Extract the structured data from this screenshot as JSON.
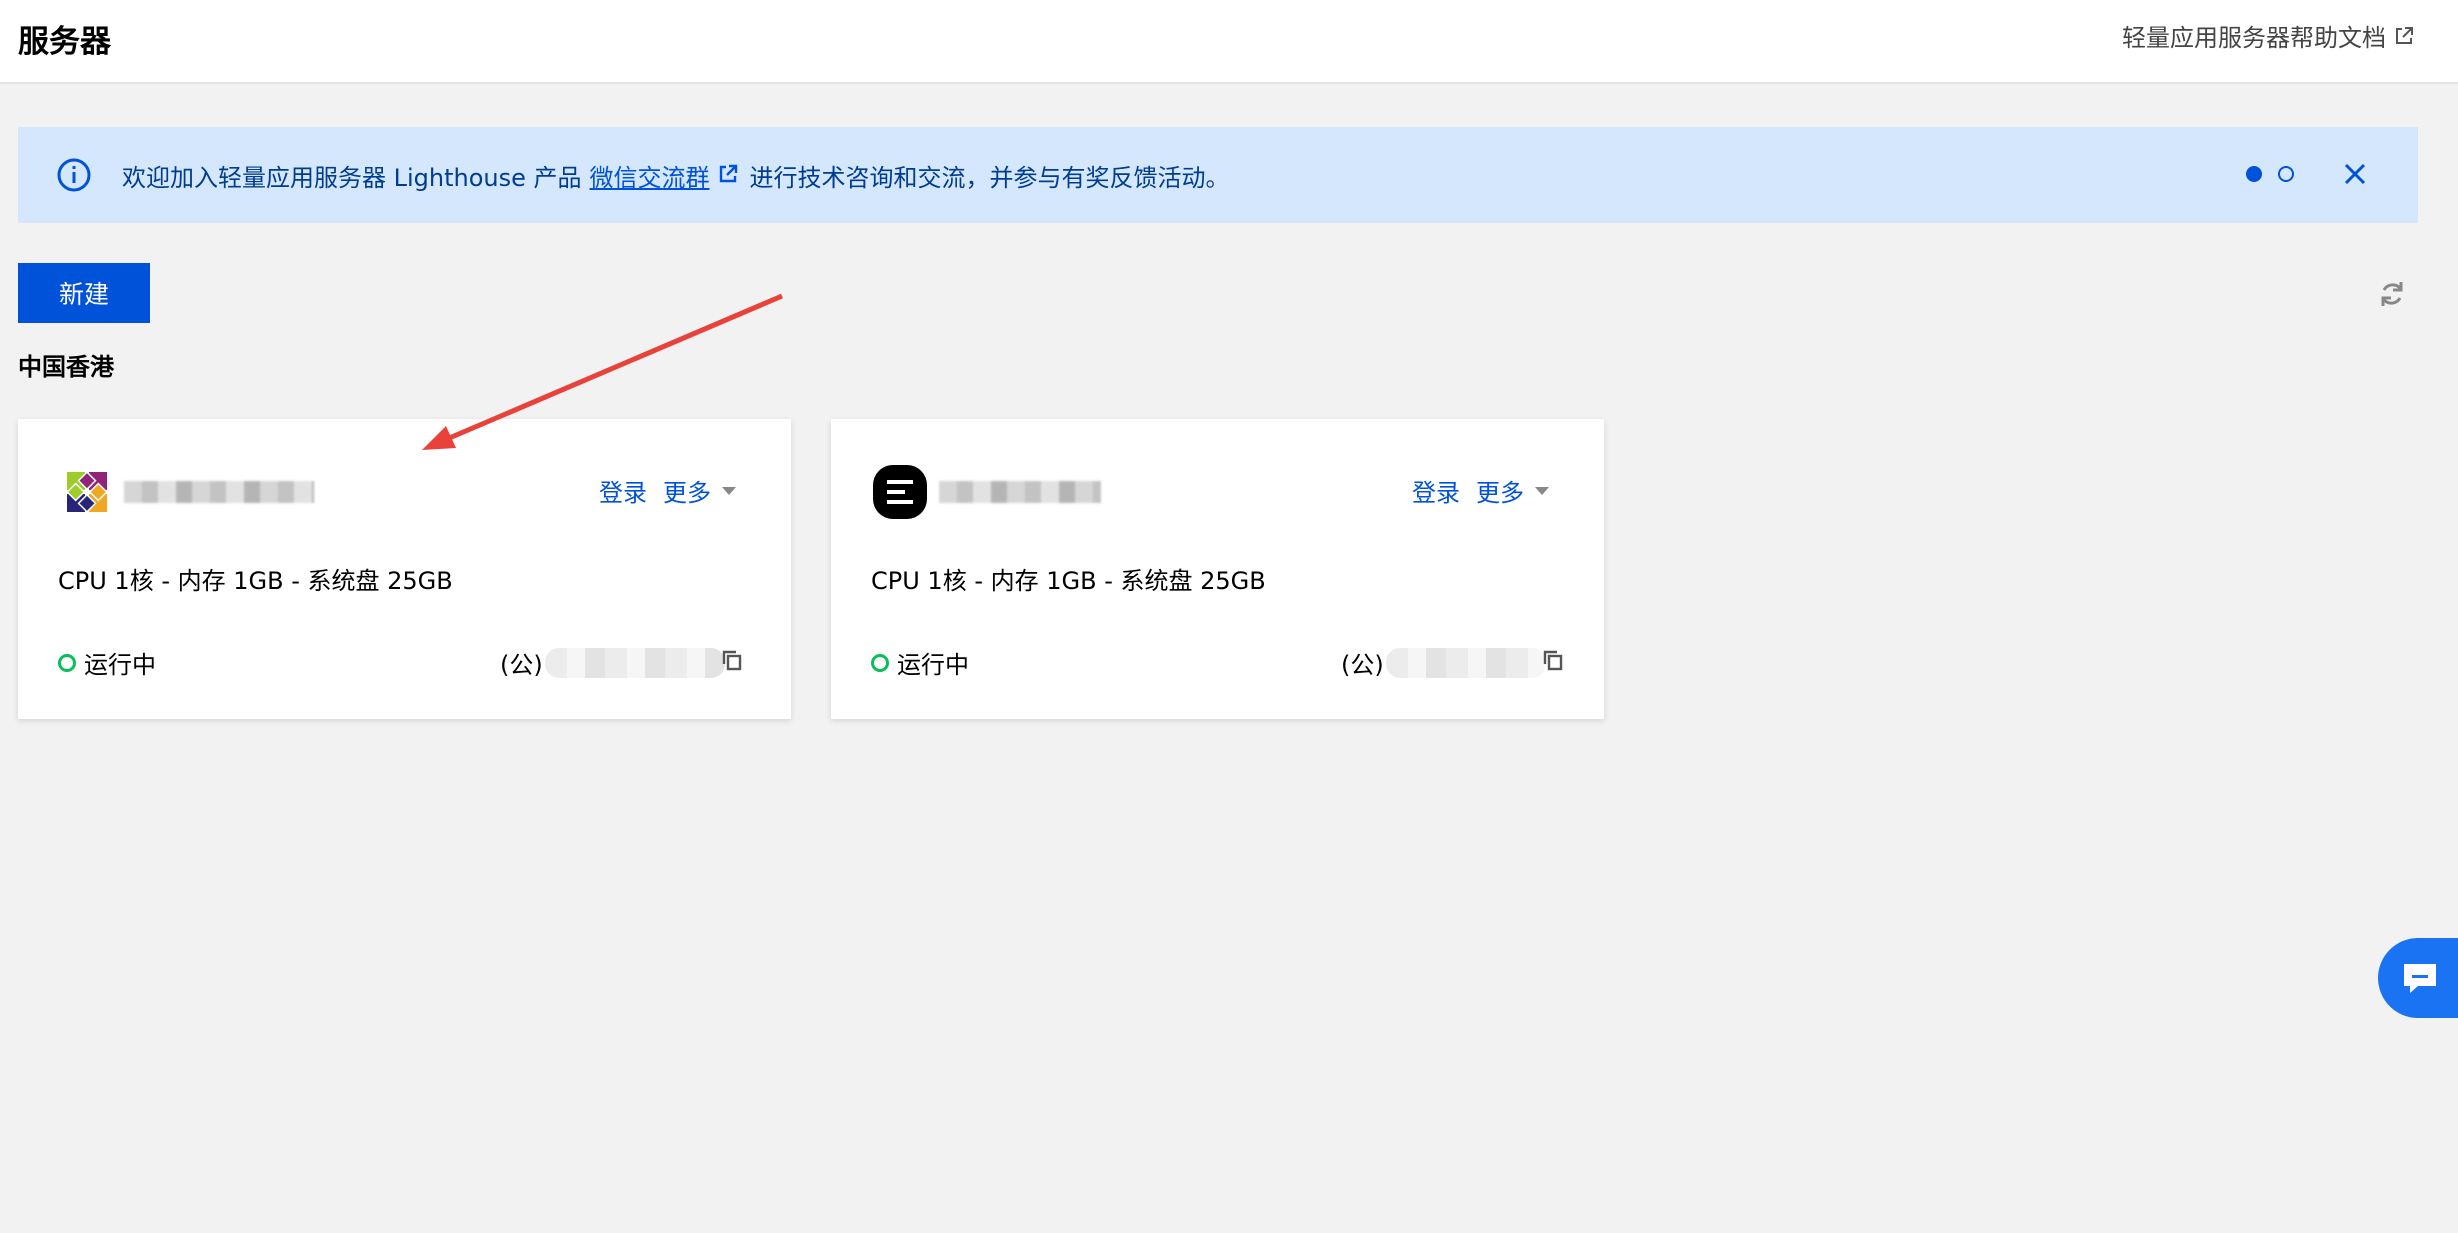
{
  "header": {
    "title": "服务器",
    "help_link": "轻量应用服务器帮助文档"
  },
  "banner": {
    "text_before": "欢迎加入轻量应用服务器 Lighthouse 产品",
    "link_text": "微信交流群",
    "text_after": "进行技术咨询和交流，并参与有奖反馈活动。",
    "pages": 2,
    "active_page": 1
  },
  "toolbar": {
    "new_label": "新建"
  },
  "region": {
    "title": "中国香港"
  },
  "cards": [
    {
      "logo": "centos-logo",
      "login_label": "登录",
      "more_label": "更多",
      "spec": "CPU 1核 - 内存 1GB - 系统盘 25GB",
      "status": "运行中",
      "ip_prefix": "(公)"
    },
    {
      "logo": "e-app-logo",
      "login_label": "登录",
      "more_label": "更多",
      "spec": "CPU 1核 - 内存 1GB - 系统盘 25GB",
      "status": "运行中",
      "ip_prefix": "(公)"
    }
  ],
  "colors": {
    "primary": "#0052d9",
    "banner_bg": "#d5e7fd",
    "status_running": "#0abf5b",
    "annotation_arrow": "#e8423b"
  }
}
